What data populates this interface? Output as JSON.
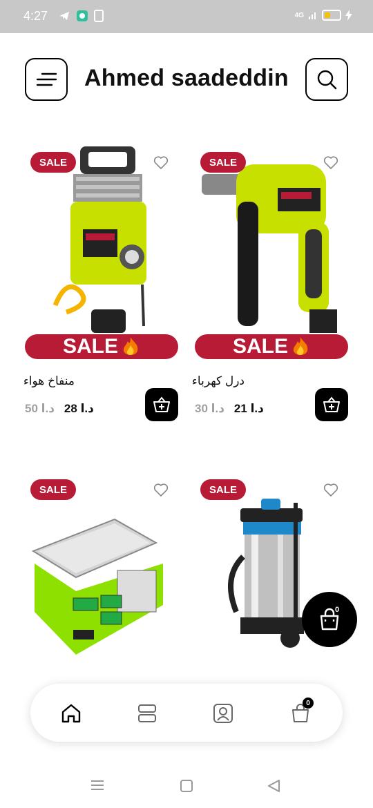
{
  "status_bar": {
    "time": "4:27",
    "network": "4G"
  },
  "header": {
    "title": "Ahmed saadeddin"
  },
  "badge_text": "SALE",
  "banner_text": "SALE",
  "products": [
    {
      "name": "منفاخ هواء",
      "price": "28 د.ا",
      "old_price": "50 د.ا"
    },
    {
      "name": "درل كهرباء",
      "price": "21 د.ا",
      "old_price": "30 د.ا"
    },
    {
      "name": "",
      "price": "",
      "old_price": ""
    },
    {
      "name": "",
      "price": "",
      "old_price": ""
    }
  ],
  "floating_cart": {
    "count": "0"
  },
  "bottom_nav": {
    "cart_count": "0"
  },
  "colors": {
    "accent": "#b81b35",
    "product_green": "#c8e000",
    "dark": "#000000"
  },
  "icons": [
    "menu-icon",
    "search-icon",
    "heart-icon",
    "basket-add-icon",
    "shopping-bag-icon",
    "home-icon",
    "categories-icon",
    "profile-icon",
    "cart-icon"
  ]
}
